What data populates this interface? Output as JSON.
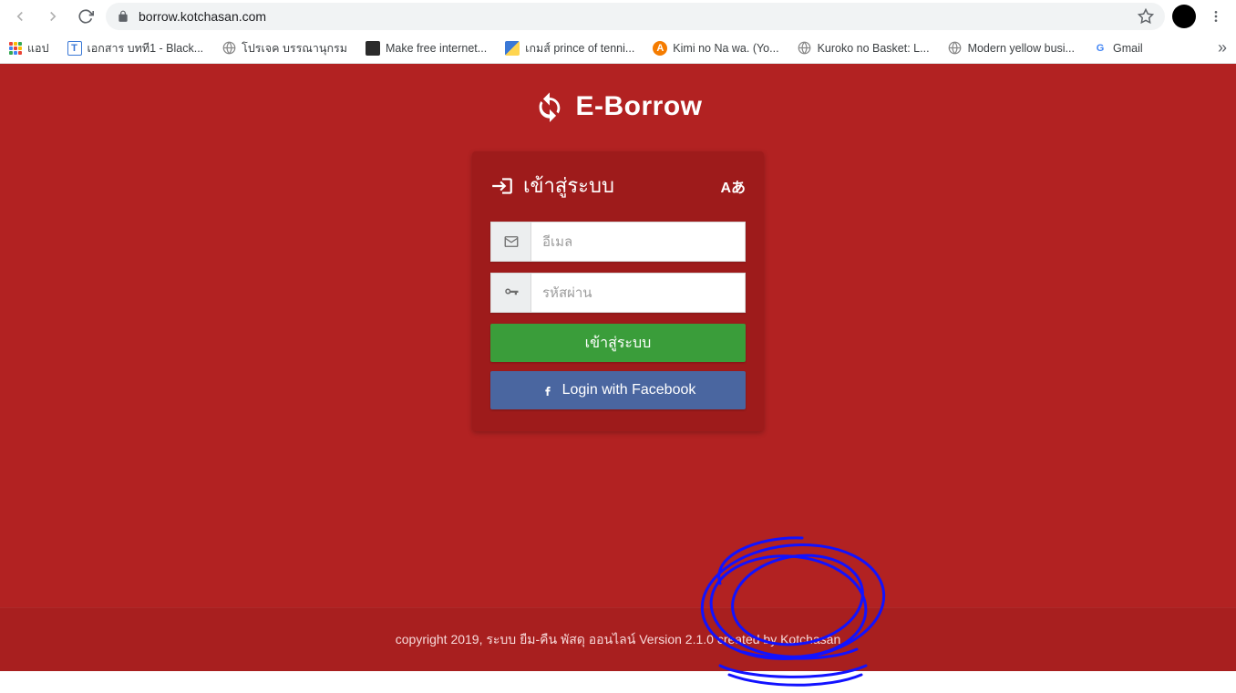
{
  "browser": {
    "url": "borrow.kotchasan.com",
    "bookmarks": [
      {
        "label": "แอป",
        "icon": "apps"
      },
      {
        "label": "เอกสาร บทที1 - Black...",
        "icon": "blue-square"
      },
      {
        "label": "โปรเจค บรรณานุกรม",
        "icon": "globe-gray"
      },
      {
        "label": "Make free internet...",
        "icon": "dark-square"
      },
      {
        "label": "เกมส์ prince of tenni...",
        "icon": "blue-yellow"
      },
      {
        "label": "Kimi no Na wa. (Yo...",
        "icon": "orange-circle"
      },
      {
        "label": "Kuroko no Basket: L...",
        "icon": "globe-gray"
      },
      {
        "label": "Modern yellow busi...",
        "icon": "globe-gray"
      },
      {
        "label": "Gmail",
        "icon": "google-g"
      }
    ]
  },
  "logo": {
    "text": "E-Borrow"
  },
  "login": {
    "title": "เข้าสู่ระบบ",
    "lang_label": "Aあ",
    "email_placeholder": "อีเมล",
    "password_placeholder": "รหัสผ่าน",
    "submit_label": "เข้าสู่ระบบ",
    "facebook_label": "Login with Facebook"
  },
  "footer": {
    "text": "copyright 2019, ระบบ ยืม-คืน พัสดุ ออนไลน์ Version 2.1.0 created by Kotchasan"
  }
}
